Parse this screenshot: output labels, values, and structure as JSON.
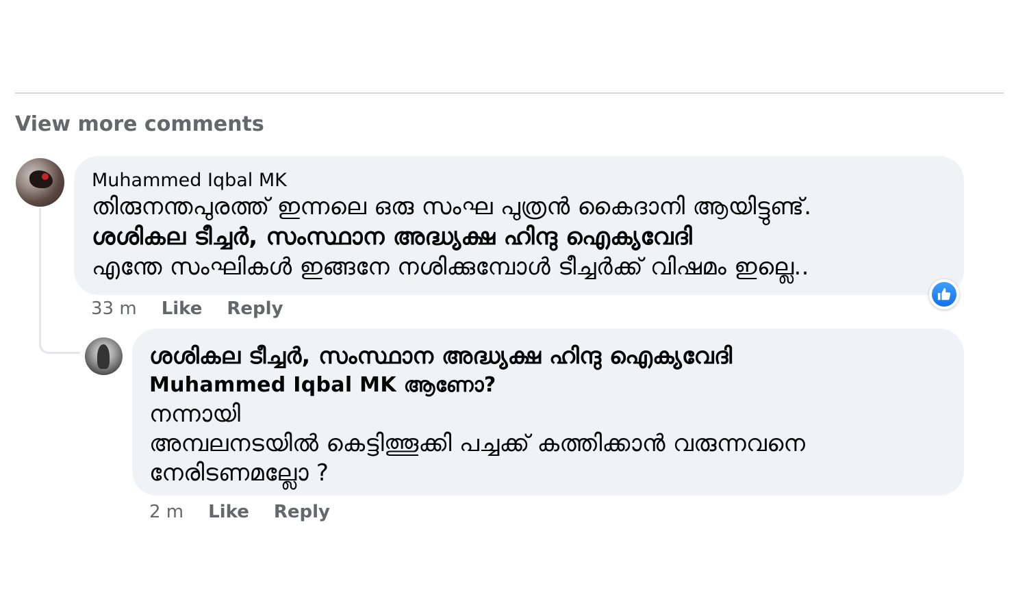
{
  "thread": {
    "view_more": "View more comments"
  },
  "comment1": {
    "author": "Muhammed Iqbal MK",
    "lines": [
      "തിരുനന്തപുരത്ത് ഇന്നലെ ഒരു സംഘ പുത്രൻ കൈദാനി ആയിട്ടുണ്ട്.",
      "ശശികല ടീച്ചർ, സംസ്ഥാന അദ്ധ്യക്ഷ ഹിന്ദു ഐക്യവേദി",
      "എന്തേ സംഘികൾ ഇങ്ങനേ നശിക്കുമ്പോൾ ടീച്ചർക്ക് വിഷമം ഇല്ലെ.."
    ],
    "time": "33 m",
    "like": "Like",
    "reply": "Reply",
    "reaction_icon": "like-reaction-icon"
  },
  "comment2": {
    "lines": [
      "ശശികല ടീച്ചർ, സംസ്ഥാന അദ്ധ്യക്ഷ ഹിന്ദു ഐക്യവേദി",
      "Muhammed Iqbal MK ആണോ?",
      "നന്നായി",
      "അമ്പലനടയിൽ കെട്ടിത്തൂക്കി പച്ചക്ക് കത്തിക്കാൻ വരുന്നവനെ",
      "നേരിടണമല്ലോ ?"
    ],
    "time": "2 m",
    "like": "Like",
    "reply": "Reply"
  },
  "colors": {
    "bubble": "#f0f2f5",
    "secondary_text": "#65676b",
    "like_blue": "#1470e8"
  }
}
